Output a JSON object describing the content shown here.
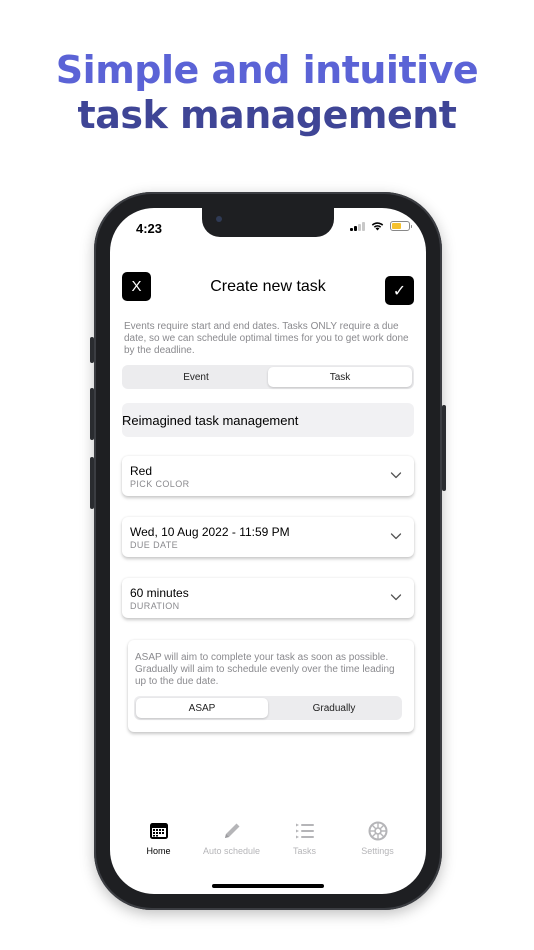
{
  "headline": {
    "line1": "Simple and intuitive",
    "line2": "task management"
  },
  "status_bar": {
    "time": "4:23"
  },
  "header": {
    "close_label": "X",
    "confirm_label": "✓",
    "title": "Create new task"
  },
  "info": {
    "text": "Events require start and end dates. Tasks ONLY require a due date, so we can schedule optimal times for you to get work done by the deadline."
  },
  "type_toggle": {
    "options": [
      "Event",
      "Task"
    ],
    "selected": "Task"
  },
  "task_name": {
    "value": "Reimagined task management",
    "placeholder": ""
  },
  "fields": [
    {
      "value": "Red",
      "caption": "PICK COLOR"
    },
    {
      "value": "Wed, 10 Aug 2022 - 11:59 PM",
      "caption": "DUE DATE"
    },
    {
      "value": "60 minutes",
      "caption": "DURATION"
    }
  ],
  "schedule_mode": {
    "description": "ASAP will aim to complete your task as soon as possible. Gradually will aim to schedule evenly over the time leading up to the due date.",
    "options": [
      "ASAP",
      "Gradually"
    ],
    "selected": "ASAP"
  },
  "tabbar": {
    "items": [
      {
        "label": "Home",
        "icon": "calendar-icon",
        "active": true
      },
      {
        "label": "Auto schedule",
        "icon": "pencil-icon",
        "active": false
      },
      {
        "label": "Tasks",
        "icon": "list-icon",
        "active": false
      },
      {
        "label": "Settings",
        "icon": "gear-icon",
        "active": false
      }
    ]
  },
  "colors": {
    "headline_light": "#5b63d6",
    "headline_dark": "#3f4596",
    "battery": "#f5c12e"
  }
}
